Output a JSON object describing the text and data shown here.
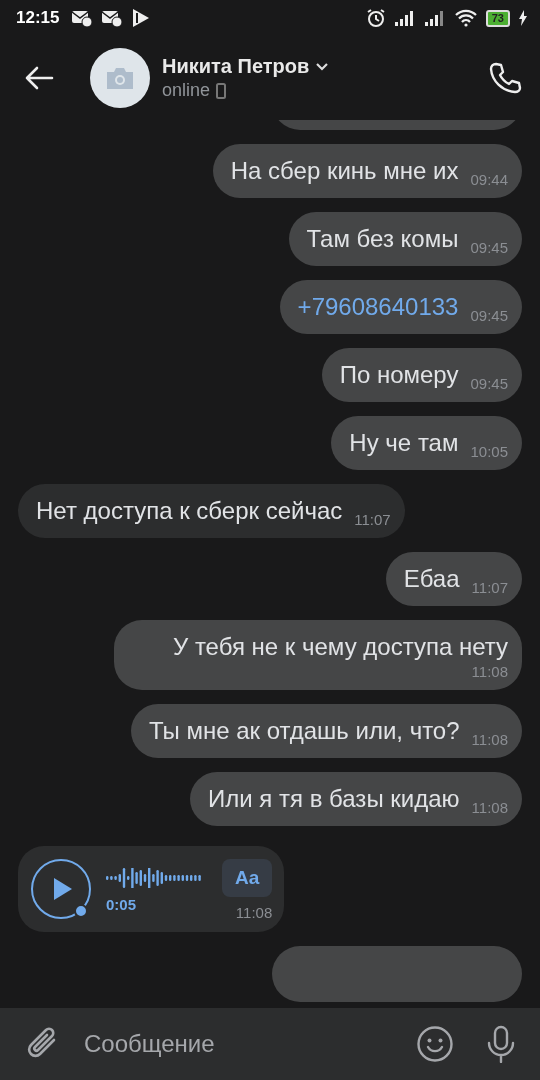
{
  "status_bar": {
    "time": "12:15",
    "battery": "73"
  },
  "header": {
    "name": "Никита Петров",
    "presence": "online"
  },
  "messages": [
    {
      "kind": "partial",
      "outgoing": true
    },
    {
      "kind": "text",
      "outgoing": true,
      "text": "На сбер кинь мне их",
      "time": "09:44"
    },
    {
      "kind": "text",
      "outgoing": true,
      "text": "Там без комы",
      "time": "09:45"
    },
    {
      "kind": "link",
      "outgoing": true,
      "text": "+79608640133",
      "time": "09:45"
    },
    {
      "kind": "text",
      "outgoing": true,
      "text": "По номеру",
      "time": "09:45"
    },
    {
      "kind": "text",
      "outgoing": true,
      "text": "Ну че там",
      "time": "10:05"
    },
    {
      "kind": "text",
      "outgoing": false,
      "text": "Нет доступа к сберк сейчас",
      "time": "11:07"
    },
    {
      "kind": "text",
      "outgoing": true,
      "text": "Ебаа",
      "time": "11:07"
    },
    {
      "kind": "text",
      "outgoing": true,
      "text": "У тебя не к чему доступа нету",
      "time": "11:08"
    },
    {
      "kind": "text",
      "outgoing": true,
      "text": "Ты мне ак отдашь или, что?",
      "time": "11:08"
    },
    {
      "kind": "text",
      "outgoing": true,
      "text": "Или я тя в базы кидаю",
      "time": "11:08"
    },
    {
      "kind": "voice",
      "outgoing": false,
      "duration": "0:05",
      "transcribe": "Aa",
      "time": "11:08"
    },
    {
      "kind": "partial",
      "outgoing": true
    }
  ],
  "composer": {
    "placeholder": "Сообщение"
  }
}
